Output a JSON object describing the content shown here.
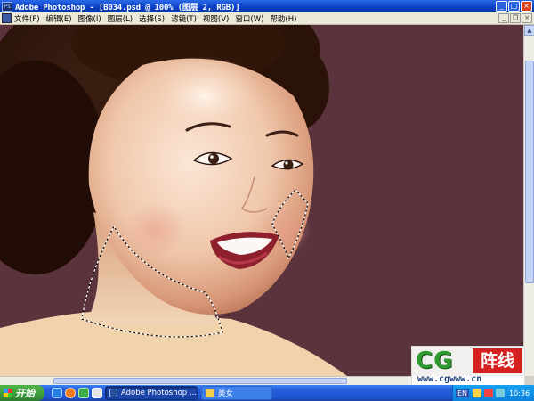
{
  "window": {
    "title": "Adobe Photoshop - [B034.psd @ 100% (图层 2, RGB)]",
    "app_icon": "Ps",
    "controls": {
      "minimize": "_",
      "maximize": "□",
      "close": "×"
    }
  },
  "menu": {
    "items": [
      "文件(F)",
      "编辑(E)",
      "图像(I)",
      "图层(L)",
      "选择(S)",
      "滤镜(T)",
      "视图(V)",
      "窗口(W)",
      "帮助(H)"
    ],
    "doc_controls": {
      "minimize": "_",
      "restore": "❐",
      "close": "×"
    }
  },
  "canvas": {
    "background_color": "#5a333c",
    "content": "illustrated portrait of a smiling woman with dark updo hair; dotted marching-ants selection along jaw and neck"
  },
  "watermark": {
    "logo_latin": "CG",
    "logo_cn": "阵线",
    "url": "www.cgwww.cn"
  },
  "taskbar": {
    "start_label": "开始",
    "tasks": [
      {
        "label": "Adobe Photoshop ...",
        "active": true
      },
      {
        "label": "美女",
        "active": false
      }
    ],
    "tray": {
      "language": "EN",
      "time": "10:36"
    }
  },
  "colors": {
    "titlebar": "#0a3fc4",
    "taskbar": "#245edb",
    "start": "#3c9c3c",
    "canvas": "#5a333c"
  }
}
